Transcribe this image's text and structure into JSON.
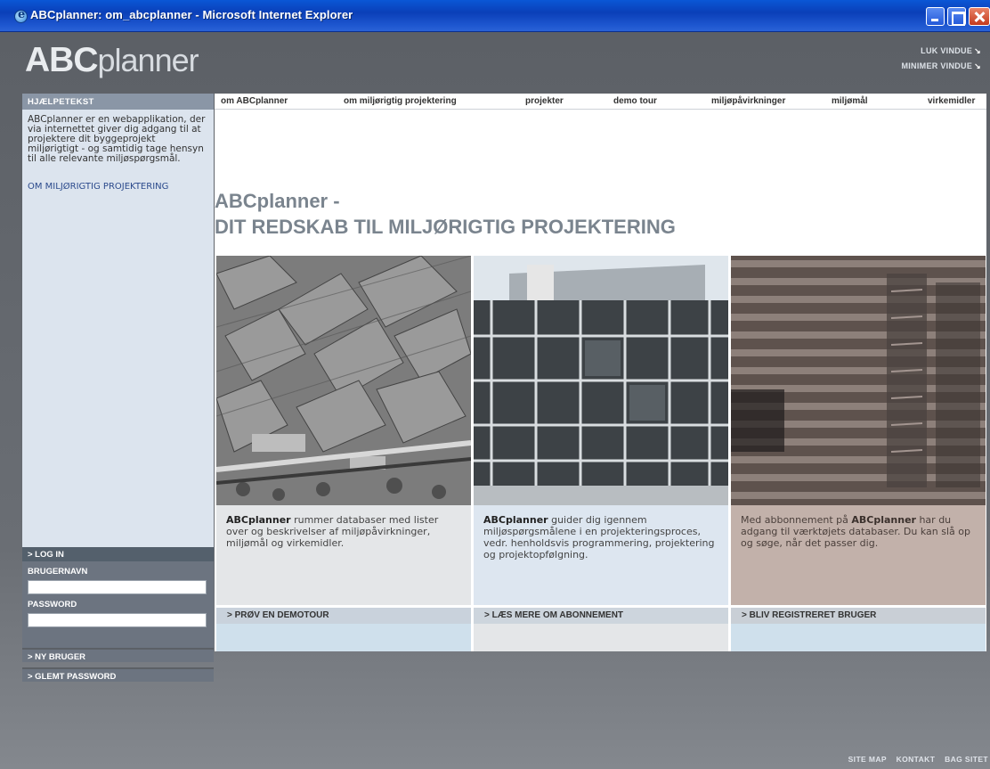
{
  "window": {
    "title": "ABCplanner: om_abcplanner - Microsoft Internet Explorer"
  },
  "logo": {
    "abc": "ABC",
    "planner": "planner"
  },
  "window_links": [
    {
      "label": "LUK VINDUE"
    },
    {
      "label": "MINIMER VINDUE"
    }
  ],
  "sidebar": {
    "heading": "HJÆLPETEKST",
    "help_text": "ABCplanner er en webapplikation, der via internettet giver dig adgang til at projektere dit byggeprojekt miljørigtigt - og samtidig tage hensyn til alle relevante miljøspørgsmål.",
    "help_link": "OM MILJØRIGTIG PROJEKTERING",
    "login_heading": "> LOG IN",
    "username_label": "BRUGERNAVN",
    "password_label": "PASSWORD",
    "new_user": "> NY BRUGER",
    "forgot_password": "> GLEMT PASSWORD"
  },
  "nav": [
    {
      "label": "om ABCplanner"
    },
    {
      "label": "om miljørigtig projektering"
    },
    {
      "label": "projekter"
    },
    {
      "label": "demo tour"
    },
    {
      "label": "miljøpåvirkninger"
    },
    {
      "label": "miljømål"
    },
    {
      "label": "virkemidler"
    }
  ],
  "headline": {
    "line1": "ABCplanner -",
    "line2": "DIT REDSKAB TIL MILJØRIGTIG PROJEKTERING"
  },
  "columns": [
    {
      "bold": "ABCplanner",
      "text": " rummer databaser med lister over og beskrivelser af miljøpåvirkninger, miljømål og virkemidler.",
      "cta": "> PRØV EN DEMOTOUR"
    },
    {
      "bold": "ABCplanner",
      "text": " guider dig igennem miljøspørgsmålene i en projekteringsproces, vedr. henholdsvis programmering, projektering og projektopfølgning.",
      "cta": "> LÆS MERE OM ABONNEMENT"
    },
    {
      "pre": "Med abbonnement på ",
      "bold": "ABCplanner",
      "text": " har du adgang til værktøjets databaser. Du kan slå op og søge, når det passer dig.",
      "cta": "> BLIV REGISTRERET BRUGER"
    }
  ],
  "footer": [
    {
      "label": "SITE MAP"
    },
    {
      "label": "KONTAKT"
    },
    {
      "label": "BAG SITET"
    }
  ]
}
